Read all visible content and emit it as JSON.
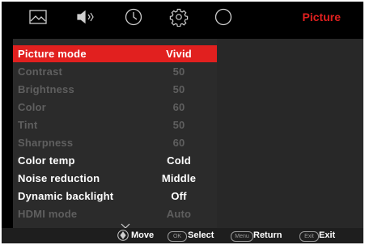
{
  "tabs": [
    {
      "icon": "picture-icon"
    },
    {
      "icon": "speaker-icon"
    },
    {
      "icon": "clock-icon"
    },
    {
      "icon": "settings-gear-icon"
    },
    {
      "icon": "search-icon"
    }
  ],
  "active_tab_title": "Picture",
  "menu": {
    "items": [
      {
        "label": "Picture mode",
        "value": "Vivid",
        "state": "selected"
      },
      {
        "label": "Contrast",
        "value": "50",
        "state": "disabled"
      },
      {
        "label": "Brightness",
        "value": "50",
        "state": "disabled"
      },
      {
        "label": "Color",
        "value": "60",
        "state": "disabled"
      },
      {
        "label": "Tint",
        "value": "50",
        "state": "disabled"
      },
      {
        "label": "Sharpness",
        "value": "60",
        "state": "disabled"
      },
      {
        "label": "Color temp",
        "value": "Cold",
        "state": "enabled"
      },
      {
        "label": "Noise reduction",
        "value": "Middle",
        "state": "enabled"
      },
      {
        "label": "Dynamic backlight",
        "value": "Off",
        "state": "enabled"
      },
      {
        "label": "HDMI mode",
        "value": "Auto",
        "state": "disabled"
      }
    ]
  },
  "footer": {
    "move_label": "Move",
    "ok_key": "OK",
    "select_label": "Select",
    "menu_key": "Menu",
    "return_label": "Return",
    "exit_key": "Exit",
    "exit_label": "Exit"
  },
  "colors": {
    "accent": "#e1201f",
    "background": "#000000",
    "panel": "#2b2b2b",
    "disabled_text": "#5f5f5f"
  }
}
